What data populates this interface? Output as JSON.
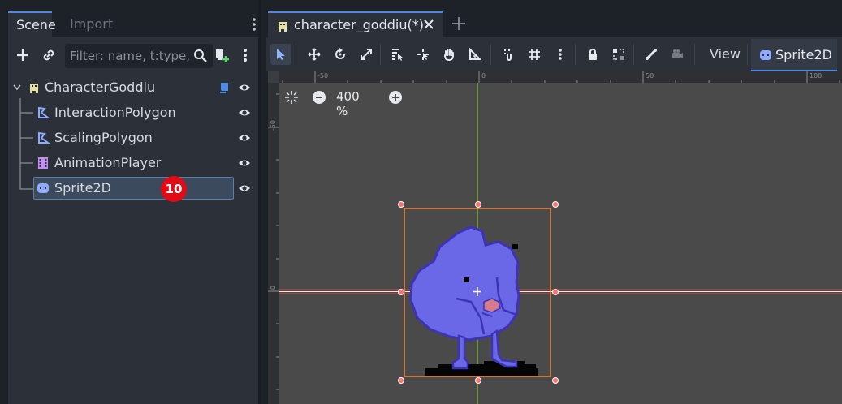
{
  "scene_dock": {
    "tabs": [
      {
        "label": "Scene"
      },
      {
        "label": "Import"
      }
    ],
    "filter_placeholder": "Filter: name, t:type, g:group",
    "tree": [
      {
        "label": "CharacterGoddiu",
        "icon": "character-body-icon",
        "has_script": true
      },
      {
        "label": "InteractionPolygon",
        "icon": "collision-polygon-icon"
      },
      {
        "label": "ScalingPolygon",
        "icon": "collision-polygon-icon"
      },
      {
        "label": "AnimationPlayer",
        "icon": "animation-player-icon"
      },
      {
        "label": "Sprite2D",
        "icon": "sprite2d-icon",
        "selected": true
      }
    ],
    "badge": "10"
  },
  "editor": {
    "scene_tab": "character_goddiu(*)",
    "toolbar": {
      "view_label": "View",
      "sprite2d_label": "Sprite2D"
    },
    "zoom": "400 %",
    "ruler_top": [
      "-50",
      "0",
      "50",
      "100"
    ],
    "ruler_left": [
      "-50",
      "0"
    ]
  },
  "colors": {
    "accent": "#4f8be2",
    "node_icon": "#8eabff",
    "sprite_body": "#6b68e8",
    "sprite_outline": "#3d33b5",
    "selection_box": "#e5894a",
    "handle": "#ff6b6b",
    "badge": "#e00b14"
  }
}
